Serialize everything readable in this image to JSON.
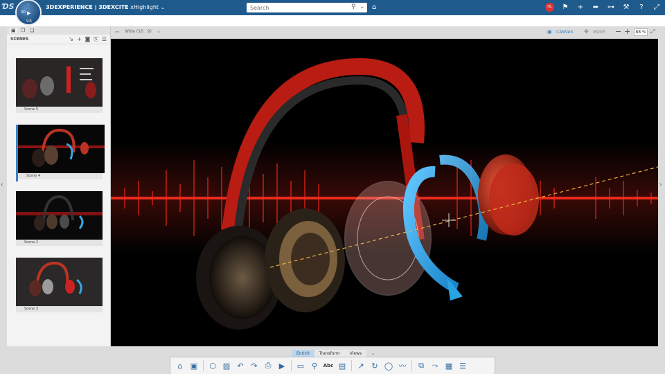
{
  "app": {
    "brand_prefix": "3DEXPERIENCE | 3DEXCITE",
    "brand_app": "xHighlight",
    "compass_labels": [
      "3D",
      "V.R",
      "i",
      "▶"
    ]
  },
  "search": {
    "placeholder": "Search"
  },
  "user": {
    "initials": "HL"
  },
  "panel": {
    "title": "SCENES",
    "scenes": [
      {
        "label": "Scene 5"
      },
      {
        "label": "Scene 4"
      },
      {
        "label": "Scene 2"
      },
      {
        "label": "Scene 3"
      }
    ]
  },
  "canvas_bar": {
    "aspect": "Wide (16 : 9)",
    "mode_canvas": "CANVAS",
    "mode_move": "MOVE",
    "zoom": "88 %"
  },
  "bottom_tabs": [
    "Enrich",
    "Transform",
    "Views"
  ],
  "colors": {
    "brand": "#1f5a8d",
    "accent": "#3b82c4",
    "sound_wave": "#e11a1a",
    "arrow": "#2aa3e0"
  },
  "icons": [
    "home-icon",
    "save-icon",
    "cube-icon",
    "image-icon",
    "undo-icon",
    "redo-icon",
    "capture-icon",
    "play-icon",
    "callout-icon",
    "annotation-icon",
    "text-icon",
    "frame-icon",
    "arrow-icon",
    "rotate-icon",
    "circle-icon",
    "line-icon",
    "explode-icon",
    "path-icon",
    "scene-icon",
    "align-icon"
  ]
}
